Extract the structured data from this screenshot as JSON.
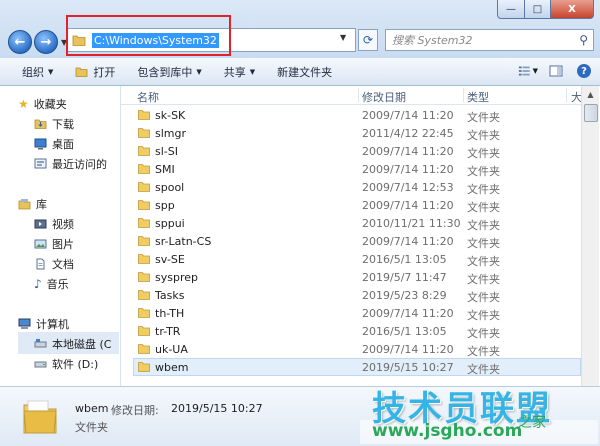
{
  "titlebar": {
    "window_buttons": {
      "minimize": "—",
      "maximize": "□",
      "close": "X"
    },
    "address_path": "C:\\Windows\\System32",
    "search_placeholder": "搜索 System32"
  },
  "toolbar": {
    "organize": "组织",
    "open": "打开",
    "include_in_library": "包含到库中",
    "share": "共享",
    "new_folder": "新建文件夹"
  },
  "sidebar": {
    "favorites": {
      "label": "收藏夹",
      "items": [
        "下载",
        "桌面",
        "最近访问的"
      ]
    },
    "libraries": {
      "label": "库",
      "items": [
        "视频",
        "图片",
        "文档",
        "音乐"
      ]
    },
    "computer": {
      "label": "计算机",
      "items": [
        "本地磁盘 (C",
        "软件 (D:)"
      ]
    }
  },
  "columns": {
    "name": "名称",
    "modified": "修改日期",
    "type": "类型",
    "size": "大"
  },
  "files": [
    {
      "name": "sk-SK",
      "date": "2009/7/14 11:20",
      "type": "文件夹"
    },
    {
      "name": "slmgr",
      "date": "2011/4/12 22:45",
      "type": "文件夹"
    },
    {
      "name": "sl-SI",
      "date": "2009/7/14 11:20",
      "type": "文件夹"
    },
    {
      "name": "SMI",
      "date": "2009/7/14 11:20",
      "type": "文件夹"
    },
    {
      "name": "spool",
      "date": "2009/7/14 12:53",
      "type": "文件夹"
    },
    {
      "name": "spp",
      "date": "2009/7/14 11:20",
      "type": "文件夹"
    },
    {
      "name": "sppui",
      "date": "2010/11/21 11:30",
      "type": "文件夹"
    },
    {
      "name": "sr-Latn-CS",
      "date": "2009/7/14 11:20",
      "type": "文件夹"
    },
    {
      "name": "sv-SE",
      "date": "2016/5/1 13:05",
      "type": "文件夹"
    },
    {
      "name": "sysprep",
      "date": "2019/5/7 11:47",
      "type": "文件夹"
    },
    {
      "name": "Tasks",
      "date": "2019/5/23 8:29",
      "type": "文件夹"
    },
    {
      "name": "th-TH",
      "date": "2009/7/14 11:20",
      "type": "文件夹"
    },
    {
      "name": "tr-TR",
      "date": "2016/5/1 13:05",
      "type": "文件夹"
    },
    {
      "name": "uk-UA",
      "date": "2009/7/14 11:20",
      "type": "文件夹"
    },
    {
      "name": "wbem",
      "date": "2019/5/15 10:27",
      "type": "文件夹"
    }
  ],
  "details": {
    "name": "wbem",
    "modified_label": "修改日期:",
    "modified_value": "2019/5/15 10:27",
    "type": "文件夹"
  },
  "watermark": {
    "text": "技术员联盟",
    "url": "www.jsgho.com",
    "tail": "之家"
  }
}
